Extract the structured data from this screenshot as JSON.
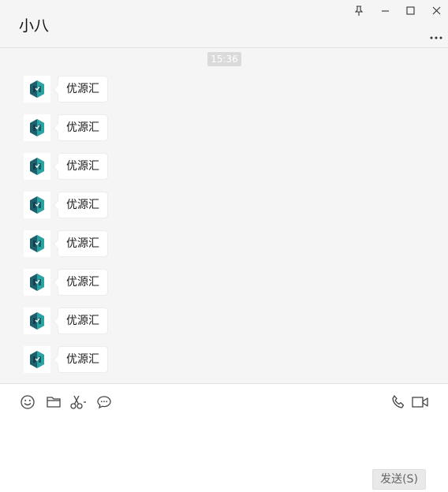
{
  "header": {
    "title": "小八"
  },
  "chat": {
    "timestamp": "15:36",
    "messages": [
      {
        "text": "优源汇"
      },
      {
        "text": "优源汇"
      },
      {
        "text": "优源汇"
      },
      {
        "text": "优源汇"
      },
      {
        "text": "优源汇"
      },
      {
        "text": "优源汇"
      },
      {
        "text": "优源汇"
      },
      {
        "text": "优源汇"
      }
    ]
  },
  "toolbar": {
    "icons": [
      "emoji-icon",
      "folder-icon",
      "scissors-icon",
      "chat-bubble-icon",
      "phone-icon",
      "video-icon"
    ]
  },
  "composer": {
    "send_label": "发送(S)"
  },
  "colors": {
    "background": "#f5f5f5",
    "bubble": "#ffffff",
    "timestamp_bg": "#dadada",
    "avatar_accent": "#2aa3a3"
  }
}
